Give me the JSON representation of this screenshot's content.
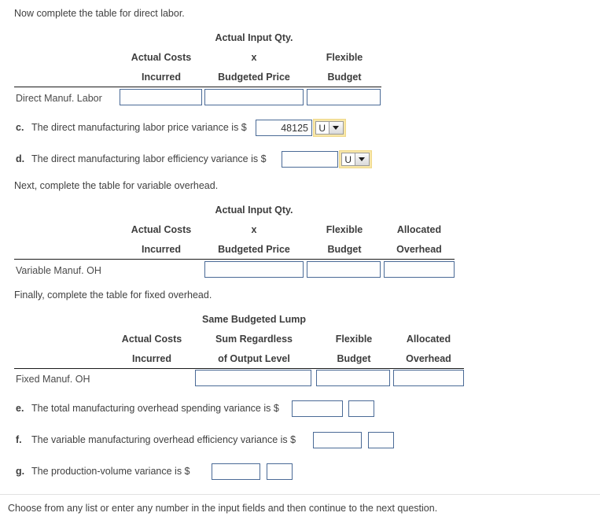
{
  "intro": {
    "direct_labor": "Now complete the table for direct labor.",
    "variable_overhead": "Next, complete the table for variable overhead.",
    "fixed_overhead": "Finally, complete the table for fixed overhead."
  },
  "tables": {
    "direct_labor": {
      "row_label": "Direct Manuf. Labor",
      "headers": [
        {
          "line1": "",
          "line2": "Actual Costs",
          "line3": "Incurred"
        },
        {
          "line1": "Actual Input Qty.",
          "line2": "x",
          "line3": "Budgeted Price"
        },
        {
          "line1": "",
          "line2": "Flexible",
          "line3": "Budget"
        }
      ],
      "cells": [
        "",
        "",
        ""
      ]
    },
    "variable_overhead": {
      "row_label": "Variable Manuf. OH",
      "headers": [
        {
          "line1": "",
          "line2": "Actual Costs",
          "line3": "Incurred"
        },
        {
          "line1": "Actual Input Qty.",
          "line2": "x",
          "line3": "Budgeted Price"
        },
        {
          "line1": "",
          "line2": "Flexible",
          "line3": "Budget"
        },
        {
          "line1": "",
          "line2": "Allocated",
          "line3": "Overhead"
        }
      ],
      "cells": [
        "",
        "",
        ""
      ]
    },
    "fixed_overhead": {
      "row_label": "Fixed Manuf. OH",
      "headers": [
        {
          "line1": "",
          "line2": "Actual Costs",
          "line3": "Incurred"
        },
        {
          "line1": "Same Budgeted Lump",
          "line2": "Sum Regardless",
          "line3": "of Output Level"
        },
        {
          "line1": "",
          "line2": "Flexible",
          "line3": "Budget"
        },
        {
          "line1": "",
          "line2": "Allocated",
          "line3": "Overhead"
        }
      ],
      "cells": [
        "",
        "",
        ""
      ]
    }
  },
  "items": {
    "c": {
      "letter": "c.",
      "text": "The direct manufacturing labor price variance is $",
      "value": "48125",
      "dropdown_value": "U"
    },
    "d": {
      "letter": "d.",
      "text": "The direct manufacturing labor efficiency variance is $",
      "value": "",
      "dropdown_value": "U"
    },
    "e": {
      "letter": "e.",
      "text": "The total manufacturing overhead spending variance is $",
      "value": "",
      "suffix_value": ""
    },
    "f": {
      "letter": "f.",
      "text": "The variable manufacturing overhead efficiency variance is $",
      "value": "",
      "suffix_value": ""
    },
    "g": {
      "letter": "g.",
      "text": "The production-volume variance is $",
      "value": "",
      "suffix_value": ""
    }
  },
  "footer": {
    "instruction": "Choose from any list or enter any number in the input fields and then continue to the next question."
  },
  "colors": {
    "input_border": "#4a6a96",
    "highlight": "#f7e6a8",
    "rule": "#1a1a1a"
  }
}
